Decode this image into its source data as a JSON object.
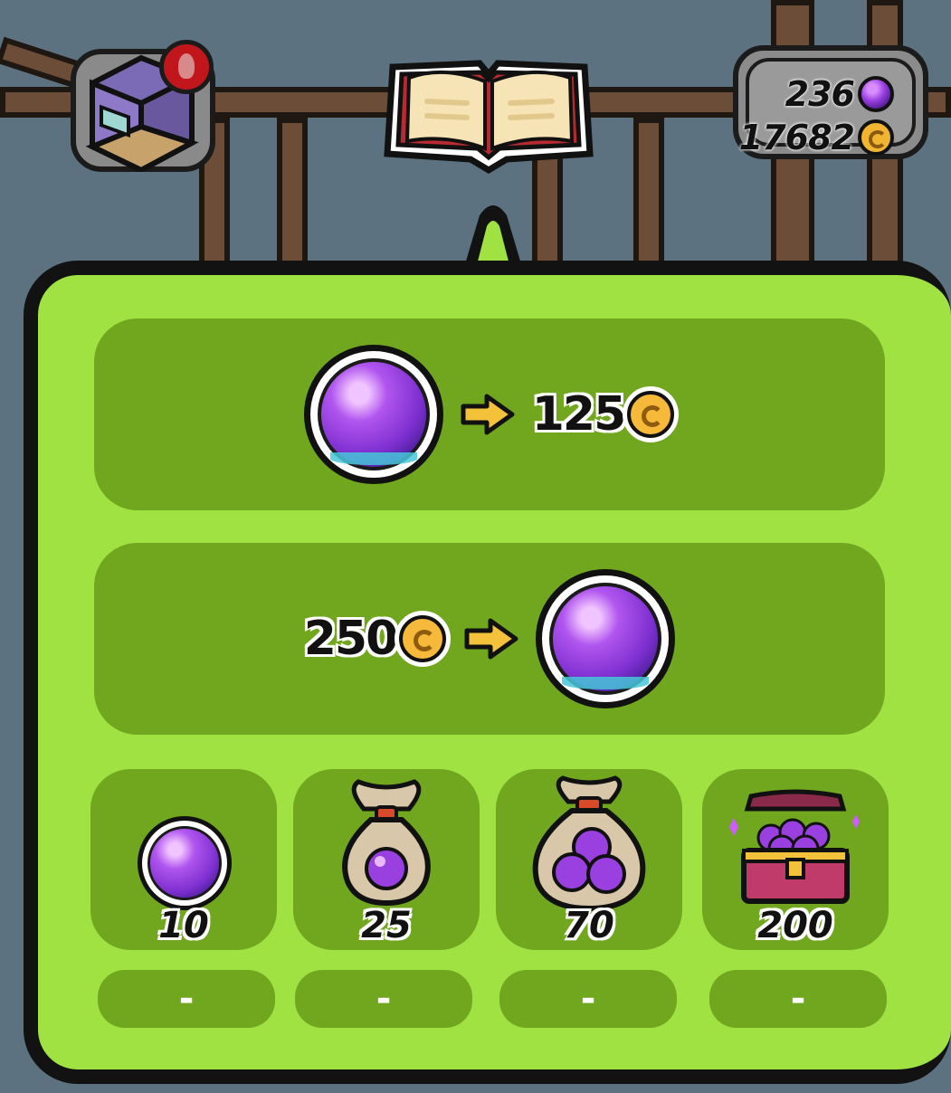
{
  "hud": {
    "gems": "236",
    "coins": "17682",
    "room_icon": "room-box-icon",
    "book_icon": "open-book-icon",
    "notification_icon": "fish-alert-icon"
  },
  "exchanges": [
    {
      "from_icon": "gem",
      "arrow": "→",
      "to_amount": "125",
      "to_icon": "coin"
    },
    {
      "from_amount": "250",
      "from_icon": "coin",
      "arrow": "→",
      "to_icon": "gem"
    }
  ],
  "packs": [
    {
      "amount": "10",
      "icon": "single-gem-icon",
      "price": "-"
    },
    {
      "amount": "25",
      "icon": "gem-pouch-icon",
      "price": "-"
    },
    {
      "amount": "70",
      "icon": "gem-sack-icon",
      "price": "-"
    },
    {
      "amount": "200",
      "icon": "gem-chest-icon",
      "price": "-"
    }
  ],
  "colors": {
    "panel": "#9fe241",
    "card": "#71a61f",
    "gem": "#9a3fe0",
    "coin": "#f6b93a"
  }
}
